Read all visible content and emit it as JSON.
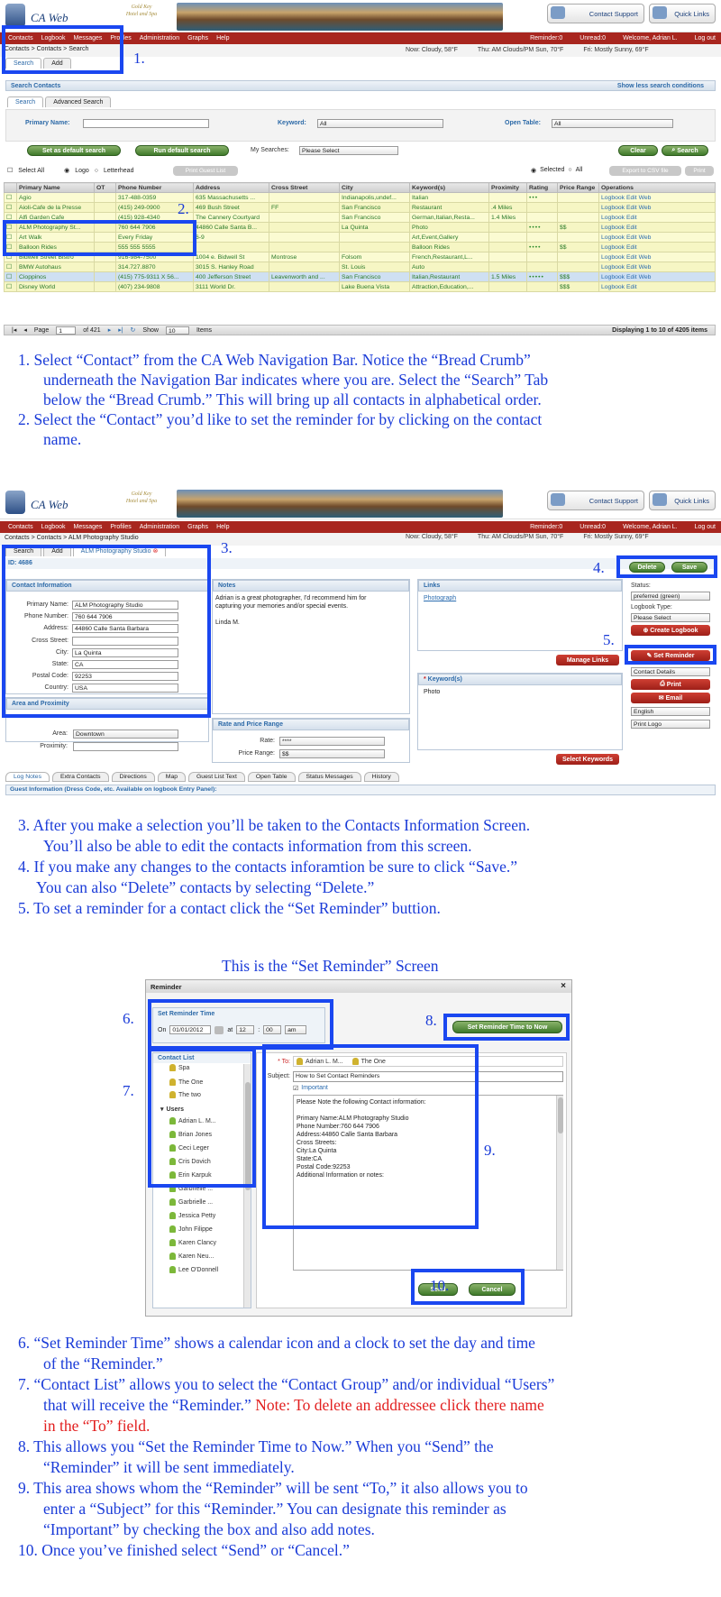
{
  "brand": {
    "name": "CA Web",
    "crest_line1": "Gold Key",
    "crest_line2": "Hotel and Spa"
  },
  "top_buttons": {
    "support": "Contact Support",
    "quick": "Quick Links"
  },
  "nav": {
    "items": [
      "Contacts",
      "Logbook",
      "Messages",
      "Profiles",
      "Administration",
      "Graphs",
      "Help"
    ],
    "reminder": "Reminder:0",
    "unread": "Unread:0",
    "welcome": "Welcome, Adrian L.",
    "logout": "Log out"
  },
  "weather": {
    "now": "Now: Cloudy, 58°F",
    "thu": "Thu: AM Clouds/PM Sun, 70°F",
    "fri": "Fri: Mostly Sunny, 69°F"
  },
  "screen1": {
    "breadcrumb": "Contacts > Contacts > Search",
    "tabs": [
      "Search",
      "Add"
    ],
    "panel_title": "Search Contacts",
    "less_link": "Show less search conditions",
    "search_tabs": [
      "Search",
      "Advanced Search"
    ],
    "primary_name_label": "Primary Name:",
    "keyword_label": "Keyword:",
    "keyword_value": "All",
    "open_table_label": "Open Table:",
    "open_table_value": "All",
    "set_default": "Set as default search",
    "run_default": "Run default search",
    "my_searches_label": "My Searches:",
    "my_searches_value": "Please Select",
    "clear": "Clear",
    "search": "Search",
    "select_all": "Select All",
    "logo": "Logo",
    "letterhead": "Letterhead",
    "print_guest": "Print Guest List",
    "selected": "Selected",
    "all": "All",
    "export": "Export to CSV file",
    "print": "Print",
    "columns": [
      "Primary Name",
      "OT",
      "Phone Number",
      "Address",
      "Cross Street",
      "City",
      "Keyword(s)",
      "Proximity",
      "Rating",
      "Price Range",
      "Operations"
    ],
    "rows": [
      [
        "Agio",
        "",
        "317-488-0359",
        "635 Massachusetts ...",
        "",
        "Indianapolis,undef...",
        "Italian",
        "",
        "•••",
        "",
        "Logbook  Edit  Web"
      ],
      [
        "Aioli-Cafe de la Presse",
        "",
        "(415) 249-0900",
        "469 Bush Street",
        "FF",
        "San Francisco",
        "Restaurant",
        ".4 Miles",
        "",
        "",
        "Logbook  Edit  Web"
      ],
      [
        "Alfi Garden Cafe",
        "",
        "(415) 928-4340",
        "The Cannery Courtyard",
        "",
        "San Francisco",
        "German,Italian,Resta...",
        "1.4 Miles",
        "",
        "",
        "Logbook  Edit"
      ],
      [
        "ALM Photography St...",
        "",
        "760 644 7906",
        "44860 Calle Santa B...",
        "",
        "La Quinta",
        "Photo",
        "",
        "••••",
        "$$",
        "Logbook  Edit"
      ],
      [
        "Art Walk",
        "",
        "Every Friday",
        "6-9",
        "",
        "",
        "Art,Event,Gallery",
        "",
        "",
        "",
        "Logbook  Edit  Web"
      ],
      [
        "Balloon Rides",
        "",
        "555 555 5555",
        "",
        "",
        "",
        "Balloon Rides",
        "",
        "••••",
        "$$",
        "Logbook  Edit"
      ],
      [
        "Bidwell Street Bistro",
        "",
        "916-984-7500",
        "1004 e. Bidwell St",
        "Montrose",
        "Folsom",
        "French,Restaurant,L...",
        "",
        "",
        "",
        "Logbook  Edit  Web"
      ],
      [
        "BMW Autohaus",
        "",
        "314.727.8870",
        "3015 S. Hanley Road",
        "",
        "St. Louis",
        "Auto",
        "",
        "",
        "",
        "Logbook  Edit  Web"
      ],
      [
        "Cioppinos",
        "",
        "(415) 775-9311 X 56...",
        "400 Jefferson Street",
        "Leavenworth and ...",
        "San Francisco",
        "Italian,Restaurant",
        "1.5 Miles",
        "•••••",
        "$$$",
        "Logbook  Edit  Web"
      ],
      [
        "Disney World",
        "",
        "(407) 234-9808",
        "3111 World Dr.",
        "",
        "Lake Buena Vista",
        "Attraction,Education,...",
        "",
        "",
        "$$$",
        "Logbook  Edit"
      ]
    ],
    "pager_page": "Page",
    "pager_value": "1",
    "pager_of": "of 421",
    "show": "Show",
    "show_value": "10",
    "items": "Items",
    "displaying": "Displaying 1 to 10 of 4205 items"
  },
  "instructions_a": [
    "1.  Select “Contact” from the CA Web Navigation Bar. Notice the “Bread Crumb”",
    "underneath the Navigation Bar indicates where you are. Select the “Search” Tab",
    "below the “Bread Crumb.” This will bring up all contacts in alphabetical order.",
    "2.  Select the “Contact” you’d like to set the reminder for by clicking on the contact",
    "name."
  ],
  "screen2": {
    "breadcrumb": "Contacts > Contacts > ALM Photography Studio",
    "tabs": [
      "Search",
      "Add",
      "ALM Photography Studio"
    ],
    "id": "ID: 4686",
    "contact_info_title": "Contact Information",
    "fields": [
      {
        "label": "Primary Name:",
        "value": "ALM Photography Studio"
      },
      {
        "label": "Phone Number:",
        "value": "760 644 7906"
      },
      {
        "label": "Address:",
        "value": "44860 Calle Santa Barbara"
      },
      {
        "label": "Cross Street:",
        "value": ""
      },
      {
        "label": "City:",
        "value": "La Quinta"
      },
      {
        "label": "State:",
        "value": "CA"
      },
      {
        "label": "Postal Code:",
        "value": "92253"
      },
      {
        "label": "Country:",
        "value": "USA"
      }
    ],
    "area_title": "Area and Proximity",
    "area_label": "Area:",
    "area_value": "Downtown",
    "proximity_label": "Proximity:",
    "notes_title": "Notes",
    "notes_line1": "Adrian is a great photographer, I'd recommend him for",
    "notes_line2": "capturing your memories and/or special events.",
    "notes_line3": "Linda M.",
    "rate_title": "Rate and Price Range",
    "rate_label": "Rate:",
    "rate_value": "****",
    "price_label": "Price Range:",
    "price_value": "$$",
    "links_title": "Links",
    "link_value": "Photograph",
    "manage_links": "Manage Links",
    "keywords_title": "Keyword(s)",
    "keyword_value": "Photo",
    "select_keywords": "Select Keywords",
    "delete": "Delete",
    "save": "Save",
    "status_label": "Status:",
    "status_value": "preferred (green)",
    "logbook_type_label": "Logbook Type:",
    "logbook_type_value": "Please Select",
    "create_logbook": "Create Logbook",
    "set_reminder": "Set Reminder",
    "contact_details": "Contact Details",
    "print": "Print",
    "email": "Email",
    "language": "English",
    "print_logo": "Print Logo",
    "bottom_tabs": [
      "Log Notes",
      "Extra Contacts",
      "Directions",
      "Map",
      "Guest List Text",
      "Open Table",
      "Status Messages",
      "History"
    ],
    "guest_info": "Guest Information (Dress Code, etc. Available on logbook Entry Panel):"
  },
  "instructions_b": [
    "3.  After you make a selection you’ll be taken to the Contacts Information Screen.",
    "You’ll also be able to edit the contacts information from this screen.",
    "4. If you make any changes to the contacts inforamtion be sure to click “Save.”",
    "You can also “Delete” contacts by selecting “Delete.”",
    "5. To set a reminder for a contact click the “Set Reminder” buttion."
  ],
  "screen3_caption": "This is the “Set Reminder” Screen",
  "reminder": {
    "title": "Reminder",
    "close": "×",
    "time_title": "Set Reminder Time",
    "on_label": "On",
    "date": "01/01/2012",
    "at_label": "at",
    "hour": "12",
    "minute": "00",
    "ampm": "am",
    "now_button": "Set Reminder Time to Now",
    "list_title": "Contact List",
    "groups": [
      "Spa",
      "The One",
      "The two"
    ],
    "users_label": "Users",
    "users": [
      "Adrian L. M...",
      "Brian Jones",
      "Ceci Leger",
      "Cris Dovich",
      "Erin Karpuk",
      "Garbrielle ...",
      "Garbrielle ...",
      "Jessica Petty",
      "John Filippe",
      "Karen Clancy",
      "Karen Neu...",
      "Lee O'Donnell"
    ],
    "to_label": "* To:",
    "to_1": "Adrian L. M...",
    "to_2": "The One",
    "subject_label": "Subject:",
    "subject_value": "How to Set Contact Reminders",
    "important": "Important",
    "body": [
      "Please Note the following Contact information:",
      "",
      "Primary Name:ALM Photography Studio",
      "Phone Number:760 644 7906",
      "Address:44860 Calle Santa Barbara",
      "Cross Streets:",
      "City:La Quinta",
      "State:CA",
      "Postal Code:92253",
      "Additional Information or notes:"
    ],
    "send": "Send",
    "cancel": "Cancel"
  },
  "instructions_c": {
    "l1": "6.  “Set Reminder Time” shows a calendar icon and a clock to set the day and time",
    "l2": "of the “Reminder.”",
    "l3": "7.  “Contact List” allows you to select the “Contact Group” and/or individual “Users”",
    "l4a": "that will receive the “Reminder.”",
    "l4b": " Note: To delete an addressee click there name",
    "l5": "in the “To” field.",
    "l6": "8.  This allows you “Set the Reminder Time to Now.”  When you “Send” the",
    "l7": "“Reminder” it will be sent immediately.",
    "l8": "9.  This area shows whom the “Reminder” will be sent “To,” it also allows you to",
    "l9": "enter a “Subject” for this “Reminder.” You can designate this reminder as",
    "l10": "“Important” by checking the box and also add notes.",
    "l11": "10. Once you’ve finished select “Send” or “Cancel.”"
  },
  "callouts": [
    "1.",
    "2.",
    "3.",
    "4.",
    "5.",
    "6.",
    "7.",
    "8.",
    "9.",
    "10."
  ]
}
